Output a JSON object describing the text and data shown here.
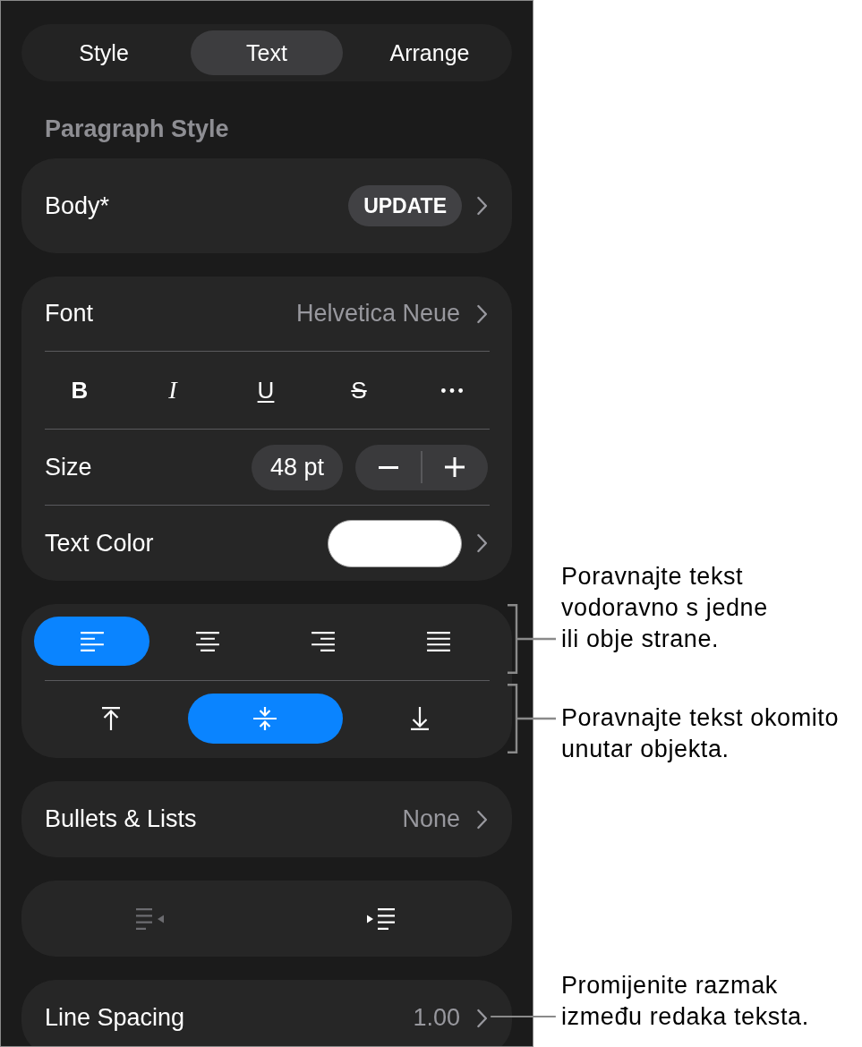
{
  "tabs": [
    {
      "label": "Style",
      "selected": false
    },
    {
      "label": "Text",
      "selected": true
    },
    {
      "label": "Arrange",
      "selected": false
    }
  ],
  "paragraph_style": {
    "heading": "Paragraph Style",
    "style_name": "Body*",
    "update_button": "UPDATE"
  },
  "font": {
    "label": "Font",
    "value": "Helvetica Neue",
    "format_buttons": [
      {
        "kind": "bold",
        "label": "B"
      },
      {
        "kind": "italic",
        "label": "I"
      },
      {
        "kind": "underline",
        "label": "U"
      },
      {
        "kind": "strikethrough",
        "label": "S"
      },
      {
        "kind": "more"
      }
    ],
    "size": {
      "label": "Size",
      "value": "48 pt"
    },
    "text_color": {
      "label": "Text Color",
      "color": "#ffffff"
    }
  },
  "alignment": {
    "horizontal": [
      {
        "kind": "left",
        "selected": true
      },
      {
        "kind": "center",
        "selected": false
      },
      {
        "kind": "right",
        "selected": false
      },
      {
        "kind": "justify",
        "selected": false
      }
    ],
    "vertical": [
      {
        "kind": "top",
        "selected": false
      },
      {
        "kind": "middle",
        "selected": true
      },
      {
        "kind": "bottom",
        "selected": false
      }
    ]
  },
  "bullets": {
    "label": "Bullets & Lists",
    "value": "None"
  },
  "indent": [
    {
      "kind": "decrease",
      "disabled": true
    },
    {
      "kind": "increase",
      "disabled": false
    }
  ],
  "line_spacing": {
    "label": "Line Spacing",
    "value": "1.00"
  },
  "callouts": [
    {
      "kind": "bracket",
      "text": "Poravnajte tekst vodoravno s jedne ili obje strane."
    },
    {
      "kind": "bracket",
      "text": "Poravnajte tekst okomito unutar objekta."
    },
    {
      "kind": "line",
      "text": "Promijenite razmak između redaka teksta."
    }
  ]
}
